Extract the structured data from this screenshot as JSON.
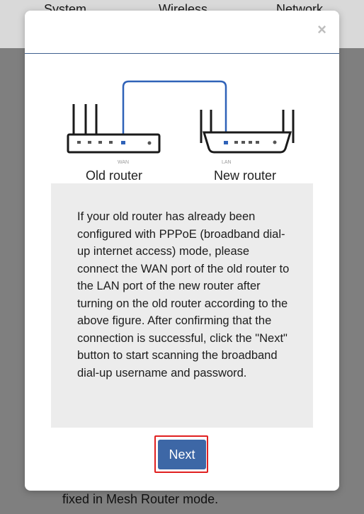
{
  "background": {
    "tabs": [
      "System",
      "Wireless",
      "Network"
    ],
    "footer_text": "fixed in Mesh Router mode."
  },
  "modal": {
    "close_label": "×",
    "diagram": {
      "old_router_label": "Old router",
      "new_router_label": "New router",
      "wan_port_label": "WAN",
      "lan_port_label": "LAN"
    },
    "info_text": "If your old router has already been configured with PPPoE (broadband dial-up internet access) mode, please connect the WAN port of the old router to the LAN port of the new router after turning on the old router according to the above figure. After confirming that the connection is successful, click the \"Next\" button to start scanning the broadband dial-up username and password.",
    "next_label": "Next"
  },
  "colors": {
    "accent": "#3d67a6",
    "cable": "#2f62b8",
    "highlight": "#e02020",
    "info_box_bg": "#ececec"
  },
  "icons": [
    "close-icon",
    "old-router-icon",
    "new-router-icon",
    "cable-icon"
  ]
}
